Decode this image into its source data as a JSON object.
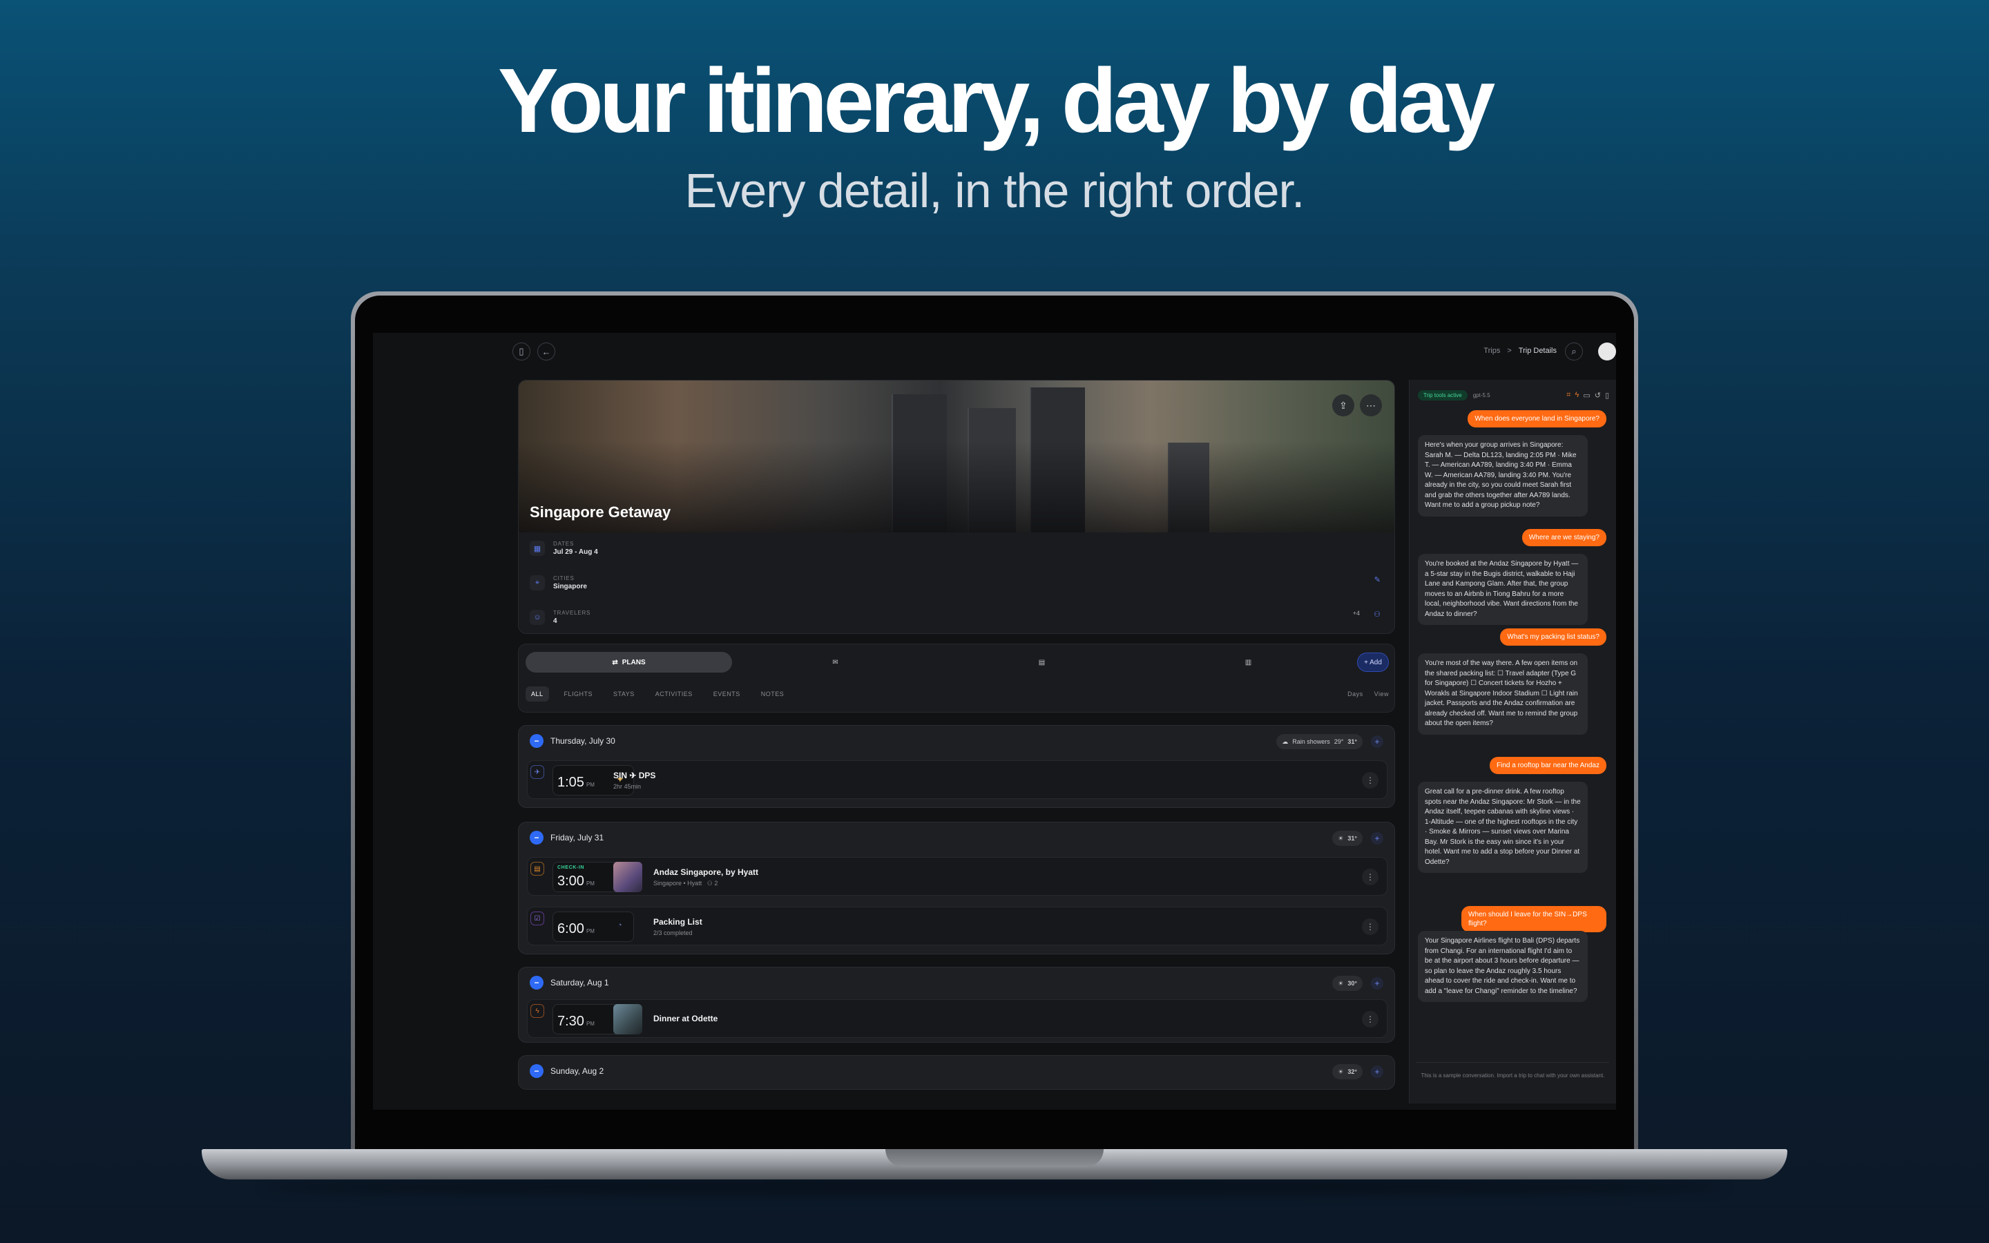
{
  "hero_text": {
    "headline": "Your itinerary, day by day",
    "subline": "Every detail, in the right order."
  },
  "topbar": {
    "crumb_parent": "Trips",
    "crumb_sep": ">",
    "crumb_current": "Trip Details"
  },
  "trip": {
    "title": "Singapore Getaway",
    "dates_label": "DATES",
    "dates_value": "Jul 29 - Aug 4",
    "cities_label": "CITIES",
    "cities_value": "Singapore",
    "travelers_label": "TRAVELERS",
    "travelers_value": "4",
    "travelers_extra": "+4"
  },
  "tabs": {
    "plans": "PLANS",
    "add": "+ Add"
  },
  "filters": {
    "all": "ALL",
    "flights": "FLIGHTS",
    "stays": "STAYS",
    "activities": "ACTIVITIES",
    "events": "EVENTS",
    "notes": "NOTES",
    "days": "Days",
    "view": "View"
  },
  "days": [
    {
      "label": "Thursday, July 30",
      "weather": "Rain showers",
      "low": "29°",
      "high": "31°",
      "items": [
        {
          "time": "1:05",
          "ampm": "PM",
          "title": "SIN ✈ DPS",
          "sub": "2hr 45min"
        }
      ]
    },
    {
      "label": "Friday, July 31",
      "high": "31°",
      "items": [
        {
          "badge": "CHECK-IN",
          "time": "3:00",
          "ampm": "PM",
          "title": "Andaz Singapore, by Hyatt",
          "sub": "Singapore • Hyatt",
          "count": "2"
        },
        {
          "time": "6:00",
          "ampm": "PM",
          "title": "Packing List",
          "sub": "2/3 completed"
        }
      ]
    },
    {
      "label": "Saturday, Aug 1",
      "high": "30°",
      "items": [
        {
          "time": "7:30",
          "ampm": "PM",
          "title": "Dinner at Odette"
        }
      ]
    },
    {
      "label": "Sunday, Aug 2",
      "high": "32°"
    }
  ],
  "chat": {
    "status": "Trip tools active",
    "model": "gpt-5.5",
    "q1": "When does everyone land in Singapore?",
    "a1": "Here's when your group arrives in Singapore: Sarah M. — Delta DL123, landing 2:05 PM · Mike T. — American AA789, landing 3:40 PM · Emma W. — American AA789, landing 3:40 PM. You're already in the city, so you could meet Sarah first and grab the others together after AA789 lands. Want me to add a group pickup note?",
    "q2": "Where are we staying?",
    "a2": "You're booked at the Andaz Singapore by Hyatt — a 5-star stay in the Bugis district, walkable to Haji Lane and Kampong Glam. After that, the group moves to an Airbnb in Tiong Bahru for a more local, neighborhood vibe. Want directions from the Andaz to dinner?",
    "q3": "What's my packing list status?",
    "a3": "You're most of the way there. A few open items on the shared packing list: ☐ Travel adapter (Type G for Singapore) ☐ Concert tickets for Hozho + Worakls at Singapore Indoor Stadium ☐ Light rain jacket. Passports and the Andaz confirmation are already checked off. Want me to remind the group about the open items?",
    "q4": "Find a rooftop bar near the Andaz",
    "a4": "Great call for a pre-dinner drink. A few rooftop spots near the Andaz Singapore: Mr Stork — in the Andaz itself, teepee cabanas with skyline views · 1-Altitude — one of the highest rooftops in the city · Smoke & Mirrors — sunset views over Marina Bay. Mr Stork is the easy win since it's in your hotel. Want me to add a stop before your Dinner at Odette?",
    "q5": "When should I leave for the SIN→DPS flight?",
    "a5": "Your Singapore Airlines flight to Bali (DPS) departs from Changi. For an international flight I'd aim to be at the airport about 3 hours before departure — so plan to leave the Andaz roughly 3.5 hours ahead to cover the ride and check-in. Want me to add a \"leave for Changi\" reminder to the timeline?",
    "footer": "This is a sample conversation. Import a trip to chat with your own assistant."
  }
}
